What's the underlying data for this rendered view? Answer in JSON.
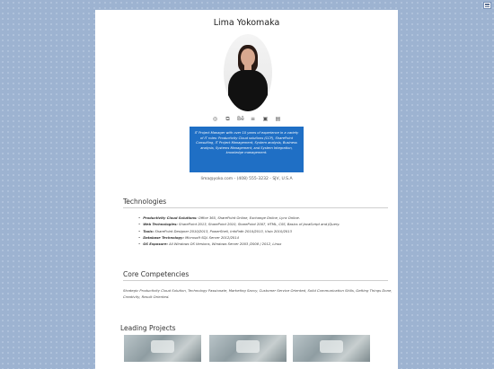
{
  "profile": {
    "name": "Lima Yokomaka",
    "bio": "IT Project Manager with over 10 years of experience in a variety of IT roles: Productivity Cloud solutions (CCP), SharePoint Consulting, IT Project Management, System analysis, Business analysis, Systems Management, and System Integration, knowledge management.",
    "contact": "lima@yoko.com - (408) 555-3232 - SJV, U.S.A"
  },
  "socials": [
    {
      "icon": "dribbble-icon",
      "glyph": "◎"
    },
    {
      "icon": "share-icon",
      "glyph": "⧉"
    },
    {
      "icon": "behance-icon",
      "glyph": "Bē"
    },
    {
      "icon": "stack-icon",
      "glyph": "≡"
    },
    {
      "icon": "linkedin-icon",
      "glyph": "▣"
    },
    {
      "icon": "youtube-icon",
      "glyph": "▤"
    }
  ],
  "technologies": {
    "title": "Technologies",
    "items": [
      {
        "label": "Productivity Cloud Solutions:",
        "value": "Office 365, SharePoint Online, Exchange Online, Lync Online."
      },
      {
        "label": "Web Technologies:",
        "value": "SharePoint 2013, SharePoint 2010, SharePoint 2007, HTML, CSS, Basics of JavaScript and JQuery."
      },
      {
        "label": "Tools:",
        "value": "SharePoint Designer 2010/2013, PowerShell, InfoPath 2010/2013, Visio 2010/2013"
      },
      {
        "label": "Database Technology:",
        "value": "Microsoft SQL Server 2012/2014"
      },
      {
        "label": "OS Exposure:",
        "value": "All Windows OS Versions, Windows Server 2003 /2008 / 2012, Linux"
      }
    ]
  },
  "competencies": {
    "title": "Core Competencies",
    "text": "Strategic Productivity Cloud Solution, Technology Passionate, Marketing Savvy, Customer Service Oriented, Solid Communication Skills, Getting Things Done, Creativity, Result Oriented."
  },
  "projects": {
    "title": "Leading Projects"
  }
}
